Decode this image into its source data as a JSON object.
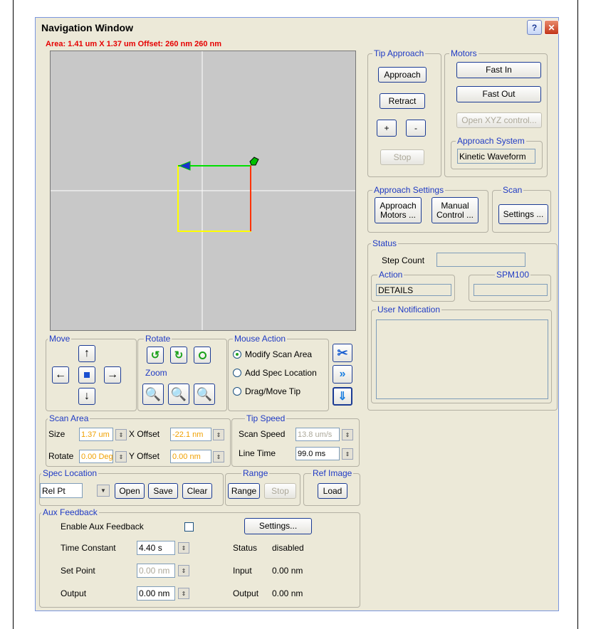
{
  "window": {
    "title": "Navigation Window",
    "help_label": "?",
    "close_label": "✕"
  },
  "area_text": "Area: 1.41 um X 1.37 um Offset: 260 nm 260 nm",
  "tip_approach": {
    "label": "Tip Approach",
    "approach": "Approach",
    "retract": "Retract",
    "plus": "+",
    "minus": "-",
    "stop": "Stop"
  },
  "motors": {
    "label": "Motors",
    "fast_in": "Fast In",
    "fast_out": "Fast Out",
    "open_xyz": "Open XYZ control...",
    "approach_system_label": "Approach System",
    "approach_system_value": "Kinetic Waveform"
  },
  "approach_settings": {
    "label": "Approach Settings",
    "approach_motors_1": "Approach",
    "approach_motors_2": "Motors ...",
    "manual_control_1": "Manual",
    "manual_control_2": "Control ..."
  },
  "scan": {
    "label": "Scan",
    "settings": "Settings ..."
  },
  "status": {
    "label": "Status",
    "step_count_label": "Step Count",
    "step_count_value": "",
    "action_label": "Action",
    "action_value": "DETAILS",
    "spm_label": "SPM100",
    "spm_value": "",
    "user_notification_label": "User Notification"
  },
  "move": {
    "label": "Move"
  },
  "rotate": {
    "label": "Rotate"
  },
  "zoom": {
    "label": "Zoom"
  },
  "mouse_action": {
    "label": "Mouse Action",
    "options": [
      "Modify Scan Area",
      "Add Spec Location",
      "Drag/Move Tip"
    ],
    "selected": "Modify Scan Area"
  },
  "scan_area": {
    "label": "Scan Area",
    "size_label": "Size",
    "size_value": "1.37 um",
    "x_offset_label": "X Offset",
    "x_offset_value": "-22.1 nm",
    "rotate_label": "Rotate",
    "rotate_value": "0.00 Deg",
    "y_offset_label": "Y Offset",
    "y_offset_value": "0.00 nm"
  },
  "tip_speed": {
    "label": "Tip Speed",
    "scan_speed_label": "Scan Speed",
    "scan_speed_value": "13.8 um/s",
    "line_time_label": "Line Time",
    "line_time_value": "99.0 ms"
  },
  "spec_location": {
    "label": "Spec Location",
    "select_value": "Rel Pt",
    "open": "Open",
    "save": "Save",
    "clear": "Clear"
  },
  "range": {
    "label": "Range",
    "range": "Range",
    "stop": "Stop"
  },
  "ref_image": {
    "label": "Ref Image",
    "load": "Load"
  },
  "aux_feedback": {
    "label": "Aux Feedback",
    "enable_label": "Enable Aux Feedback",
    "settings": "Settings...",
    "time_constant_label": "Time Constant",
    "time_constant_value": "4.40 s",
    "set_point_label": "Set Point",
    "set_point_value": "0.00 nm",
    "output_label": "Output",
    "output_value": "0.00 nm",
    "status_label": "Status",
    "status_value": "disabled",
    "input_label": "Input",
    "input_value": "0.00 nm",
    "output2_label": "Output",
    "output2_value": "0.00 nm"
  },
  "colors": {
    "accent": "#1f3ac4",
    "area_text": "#e60000",
    "scan_box": "#ffff00",
    "scan_top": "#00e000",
    "scan_right": "#ff3300"
  }
}
